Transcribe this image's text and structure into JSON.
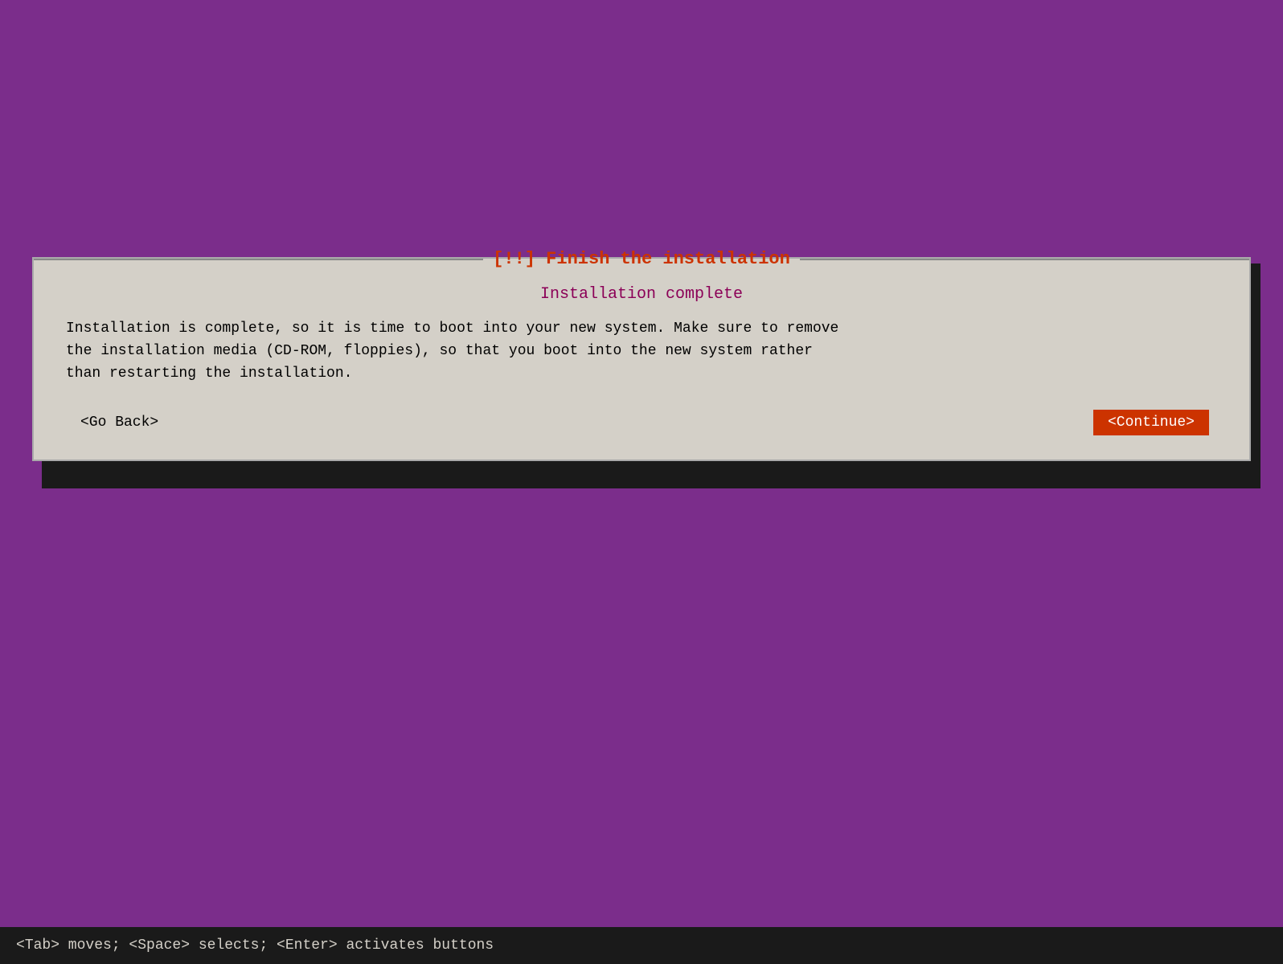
{
  "background_color": "#7b2d8b",
  "dialog": {
    "title": "[!!] Finish the installation",
    "subtitle": "Installation complete",
    "message_line1": "Installation is complete, so it is time to boot into your new system. Make sure to remove",
    "message_line2": "the installation media (CD-ROM, floppies), so that you boot into the new system rather",
    "message_line3": "than restarting the installation.",
    "go_back_label": "<Go Back>",
    "continue_label": "<Continue>"
  },
  "bottom_bar": {
    "text": "<Tab> moves; <Space> selects; <Enter> activates buttons"
  }
}
